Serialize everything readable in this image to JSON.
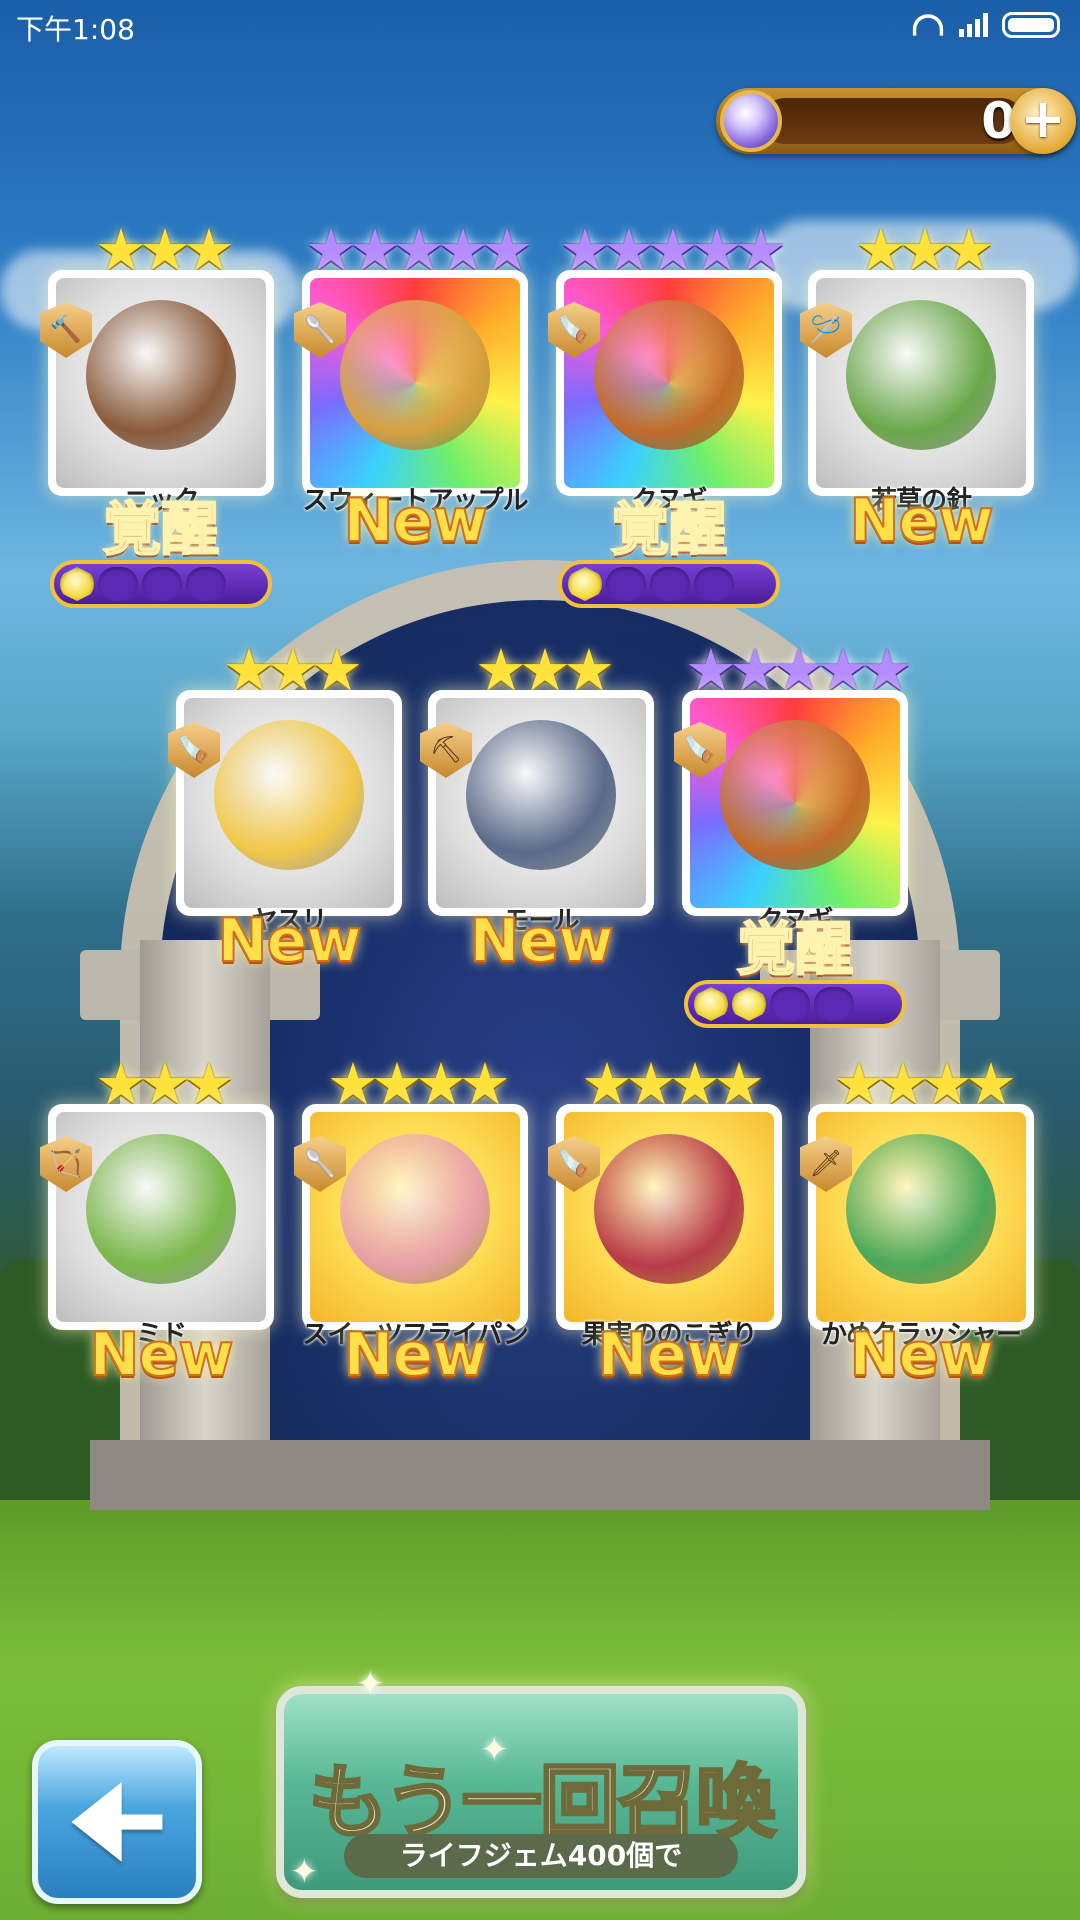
{
  "status_bar": {
    "time": "下午1:08"
  },
  "currency": {
    "amount": "0",
    "add_symbol": "+"
  },
  "cards": [
    {
      "name": "ニック",
      "stars": "★★★",
      "star_color": "gold",
      "label": "覚醒",
      "awaken_filled": 1,
      "awaken_total": 4,
      "type_icon": "hammer-icon",
      "art": "grey"
    },
    {
      "name": "スウィートアップル",
      "stars": "★★★★★",
      "star_color": "purple",
      "label": "New",
      "type_icon": "ladle-icon",
      "art": "rainbow"
    },
    {
      "name": "クヌギ",
      "stars": "★★★★★",
      "star_color": "purple",
      "label": "覚醒",
      "awaken_filled": 1,
      "awaken_total": 4,
      "type_icon": "saw-icon",
      "art": "rainbow"
    },
    {
      "name": "若草の針",
      "stars": "★★★",
      "star_color": "gold",
      "label": "New",
      "type_icon": "needle-icon",
      "art": "grey"
    },
    {
      "name": "ヤスリ",
      "stars": "★★★",
      "star_color": "gold",
      "label": "New",
      "type_icon": "saw-icon",
      "art": "grey"
    },
    {
      "name": "モール",
      "stars": "★★★",
      "star_color": "gold",
      "label": "New",
      "type_icon": "pickaxe-icon",
      "art": "grey"
    },
    {
      "name": "クヌギ",
      "stars": "★★★★★",
      "star_color": "purple",
      "label": "覚醒",
      "awaken_filled": 2,
      "awaken_total": 4,
      "type_icon": "saw-icon",
      "art": "rainbow"
    },
    {
      "name": "ミド",
      "stars": "★★★",
      "star_color": "gold",
      "label": "New",
      "type_icon": "bow-icon",
      "art": "grey"
    },
    {
      "name": "スイーツフライパン",
      "stars": "★★★★",
      "star_color": "gold",
      "label": "New",
      "type_icon": "ladle-icon",
      "art": "gold"
    },
    {
      "name": "果実ののこぎり",
      "stars": "★★★★",
      "star_color": "gold",
      "label": "New",
      "type_icon": "saw-icon",
      "art": "gold"
    },
    {
      "name": "かめクラッシャー",
      "stars": "★★★★",
      "star_color": "gold",
      "label": "New",
      "type_icon": "sword-icon",
      "art": "gold"
    }
  ],
  "summon_again": {
    "label": "もう一回召喚",
    "sub_label": "ライフジェム400個で"
  },
  "colors": {
    "new_text": "#ffe04a",
    "awaken_text": "#ff5a2a",
    "awaken_bar": "#5b2ab4",
    "gold_star": "#ffe23a",
    "purple_star": "#b48cff"
  }
}
